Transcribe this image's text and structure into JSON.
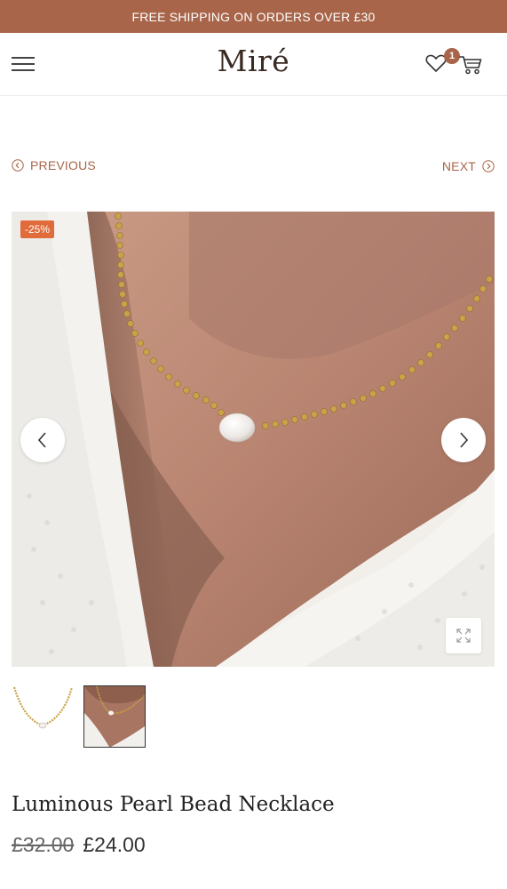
{
  "promo": {
    "text": "FREE SHIPPING ON ORDERS OVER £30"
  },
  "header": {
    "logo": "Miré",
    "menu_icon": "hamburger-menu-icon",
    "wishlist_icon": "heart-icon",
    "wishlist_count": "1",
    "cart_icon": "cart-icon"
  },
  "product_nav": {
    "previous_label": "PREVIOUS",
    "next_label": "NEXT"
  },
  "gallery": {
    "badge": "-25%",
    "prev_icon": "chevron-left-icon",
    "next_icon": "chevron-right-icon",
    "zoom_icon": "expand-icon",
    "thumbnails": [
      "necklace-product-thumbnail",
      "necklace-worn-thumbnail"
    ],
    "active_thumbnail": 2
  },
  "product": {
    "title": "Luminous Pearl Bead Necklace",
    "price_old": "£32.00",
    "price_new": "£24.00"
  },
  "colors": {
    "accent": "#a8654a",
    "badge": "#e16b3a"
  }
}
